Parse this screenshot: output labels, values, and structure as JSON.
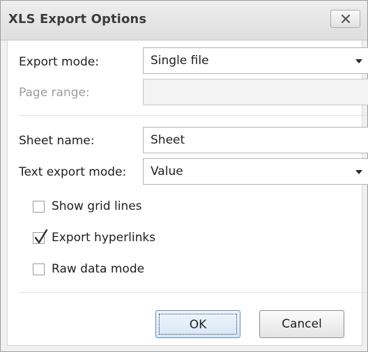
{
  "dialog": {
    "title": "XLS Export Options",
    "close_icon": "close-x-icon"
  },
  "fields": {
    "export_mode_label": "Export mode:",
    "export_mode_value": "Single file",
    "page_range_label": "Page range:",
    "page_range_value": "",
    "sheet_name_label": "Sheet name:",
    "sheet_name_value": "Sheet",
    "text_export_mode_label": "Text export mode:",
    "text_export_mode_value": "Value"
  },
  "options": {
    "show_grid_lines": {
      "label": "Show grid lines",
      "checked": false
    },
    "export_hyperlinks": {
      "label": "Export hyperlinks",
      "checked": true
    },
    "raw_data_mode": {
      "label": "Raw data mode",
      "checked": false
    }
  },
  "buttons": {
    "ok_label": "OK",
    "cancel_label": "Cancel"
  },
  "colors": {
    "ok_button_border": "#5a8fc4",
    "disabled_text": "#9d9d9d"
  }
}
